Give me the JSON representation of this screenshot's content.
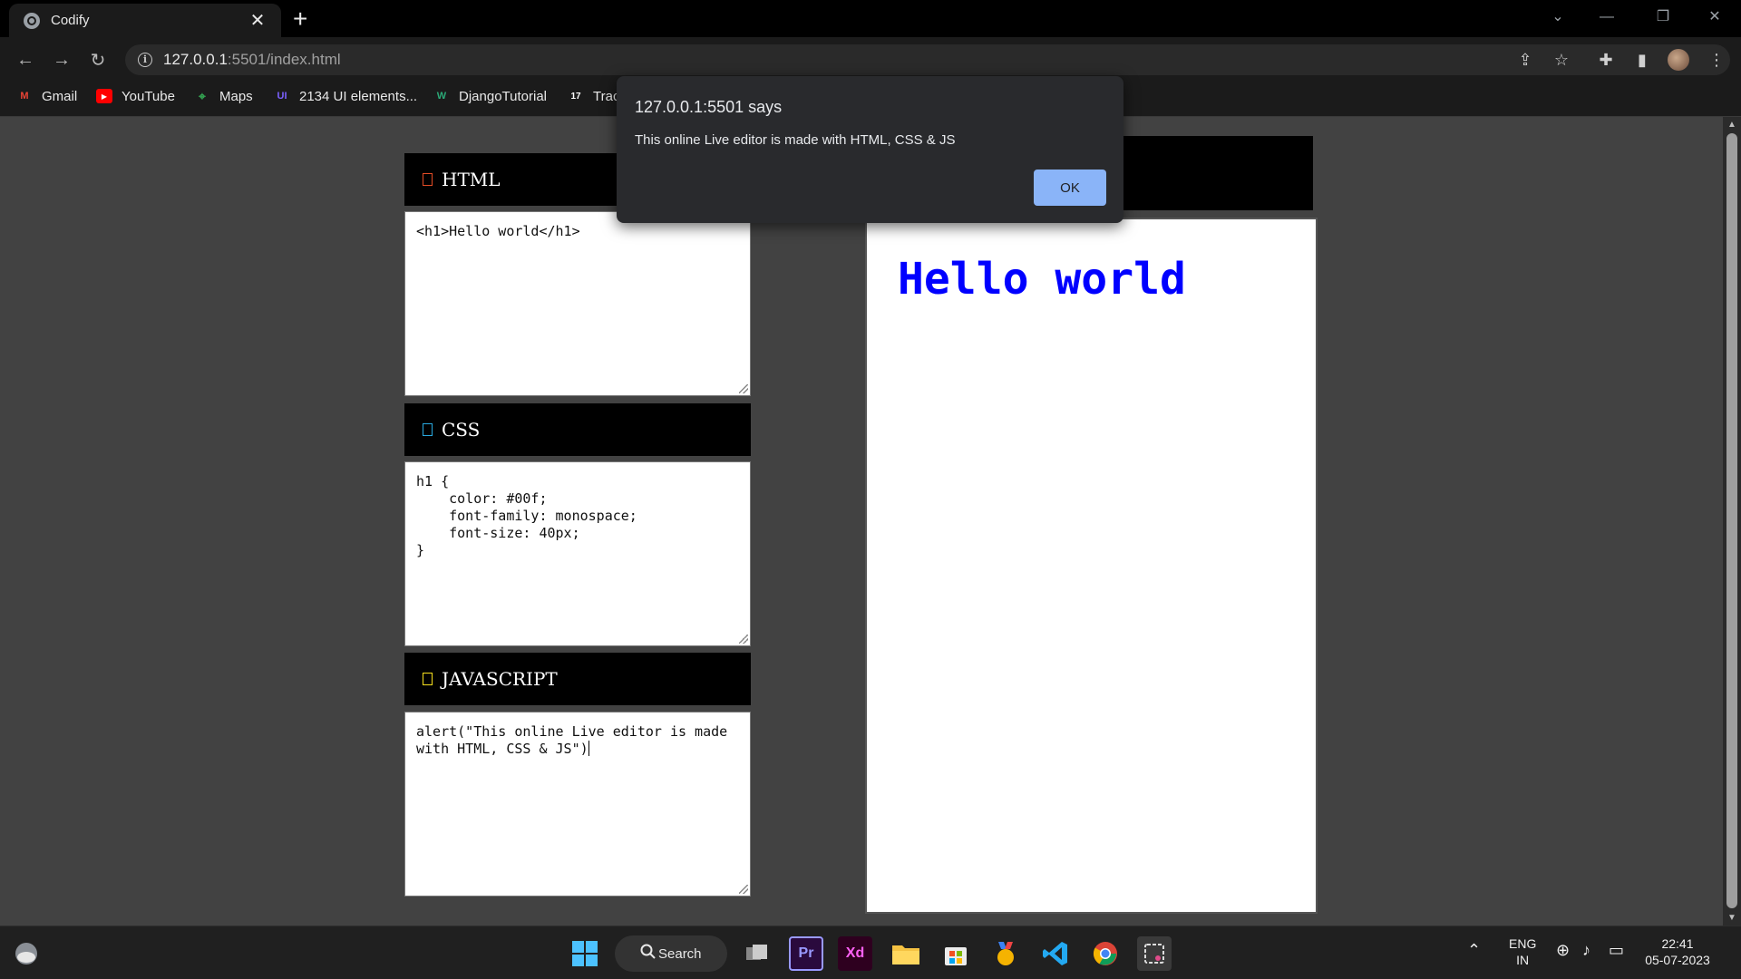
{
  "browser": {
    "tab_title": "Codify",
    "new_tab": "+",
    "url_host": "127.0.0.1",
    "url_rest": ":5501/index.html",
    "bookmarks": [
      {
        "label": "Gmail",
        "icon": "gmail-icon",
        "color": "#ea4335",
        "glyph": "M"
      },
      {
        "label": "YouTube",
        "icon": "youtube-icon",
        "color": "#ff0000",
        "glyph": "▶"
      },
      {
        "label": "Maps",
        "icon": "maps-icon",
        "color": "#34a853",
        "glyph": "⌖"
      },
      {
        "label": "2134 UI elements...",
        "icon": "uiverse-icon",
        "color": "#7b61ff",
        "glyph": "UI"
      },
      {
        "label": "DjangoTutorial",
        "icon": "django-icon",
        "color": "#2ba977",
        "glyph": "W"
      },
      {
        "label": "Trac",
        "icon": "tradingview-icon",
        "color": "#ffffff",
        "glyph": "17"
      }
    ]
  },
  "editor": {
    "html_label": "HTML",
    "html_color": "#e34c26",
    "html_code": "<h1>Hello world</h1>",
    "css_label": "CSS",
    "css_color": "#29a9df",
    "css_code": "h1 {\n    color: #00f;\n    font-family: monospace;\n    font-size: 40px;\n}",
    "js_label": "JAVASCRIPT",
    "js_color": "#f7df1e",
    "js_code_line1": "alert(\"This online Live editor is made",
    "js_code_line2": "with HTML, CSS & JS\")"
  },
  "output": {
    "heading": "Hello world",
    "heading_color": "#0000ff"
  },
  "dialog": {
    "title": "127.0.0.1:5501 says",
    "message": "This online Live editor is made with HTML, CSS & JS",
    "ok_label": "OK"
  },
  "taskbar": {
    "search_label": "Search",
    "lang_top": "ENG",
    "lang_bottom": "IN",
    "time": "22:41",
    "date": "05-07-2023"
  }
}
